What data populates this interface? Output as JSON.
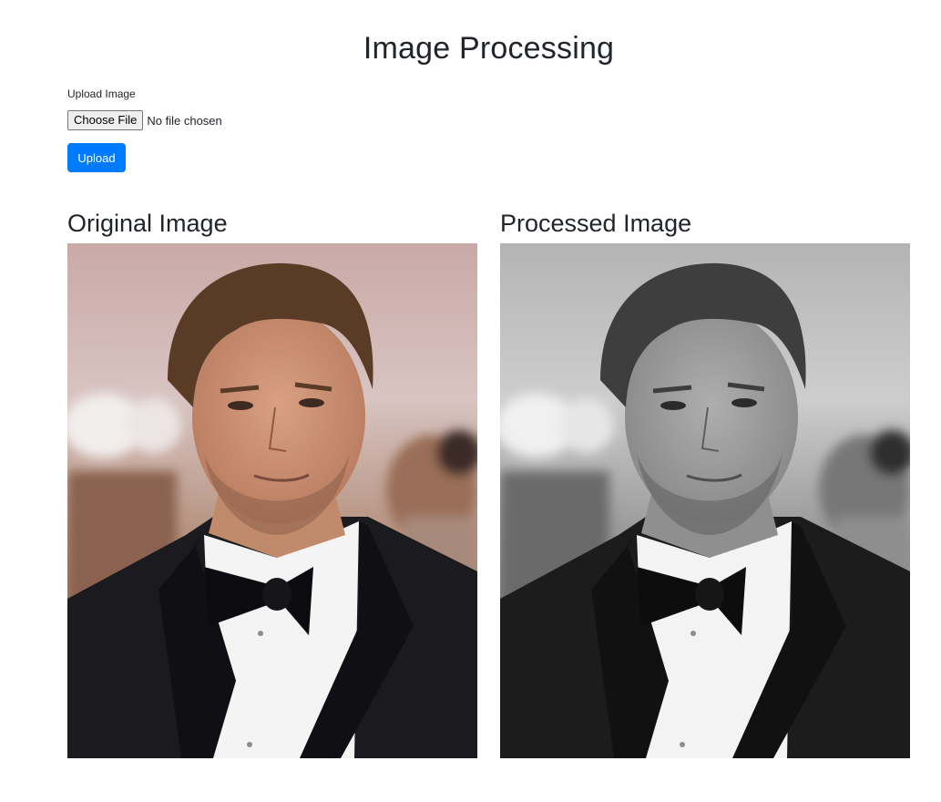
{
  "page": {
    "title": "Image Processing"
  },
  "upload_form": {
    "label": "Upload Image",
    "choose_file_label": "Choose File",
    "file_status": "No file chosen",
    "upload_button_label": "Upload"
  },
  "results": {
    "original_title": "Original Image",
    "processed_title": "Processed Image"
  },
  "colors": {
    "primary_button": "#007bff",
    "text": "#212529",
    "tuxedo": "#1b1b1f",
    "shirt": "#f4f4f4"
  }
}
